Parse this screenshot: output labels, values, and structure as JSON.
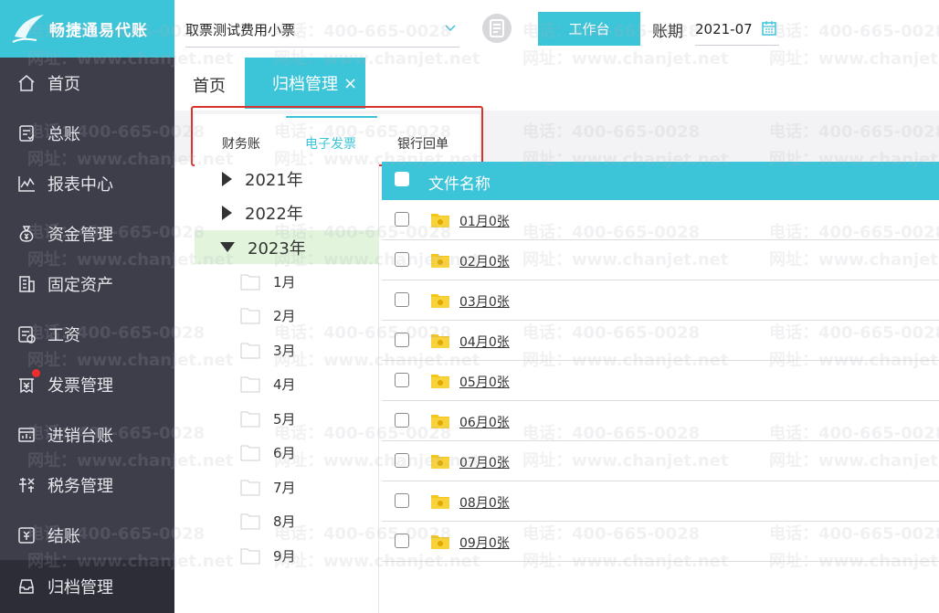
{
  "app": {
    "logo_text": "畅捷通易代账"
  },
  "sidebar": {
    "items": [
      {
        "label": "首页",
        "icon": "home-icon"
      },
      {
        "label": "总账",
        "icon": "ledger-icon"
      },
      {
        "label": "报表中心",
        "icon": "chart-icon"
      },
      {
        "label": "资金管理",
        "icon": "money-bag-icon"
      },
      {
        "label": "固定资产",
        "icon": "building-icon"
      },
      {
        "label": "工资",
        "icon": "salary-icon"
      },
      {
        "label": "发票管理",
        "icon": "invoice-icon"
      },
      {
        "label": "进销台账",
        "icon": "inventory-icon"
      },
      {
        "label": "税务管理",
        "icon": "tax-icon"
      },
      {
        "label": "结账",
        "icon": "closing-icon"
      },
      {
        "label": "归档管理",
        "icon": "archive-icon"
      }
    ]
  },
  "header": {
    "company": "取票测试费用小票",
    "workbench_label": "工作台",
    "period_label": "账期",
    "period_value": "2021-07"
  },
  "tabs": {
    "home": "首页",
    "archive": "归档管理",
    "close": "×"
  },
  "subtabs": [
    "财务账",
    "电子发票",
    "银行回单"
  ],
  "tree": {
    "years": [
      "2021年",
      "2022年",
      "2023年"
    ],
    "months": [
      "1月",
      "2月",
      "3月",
      "4月",
      "5月",
      "6月",
      "7月",
      "8月",
      "9月"
    ]
  },
  "table": {
    "header": "文件名称",
    "rows": [
      "01月0张",
      "02月0张",
      "03月0张",
      "04月0张",
      "05月0张",
      "06月0张",
      "07月0张",
      "08月0张",
      "09月0张"
    ]
  },
  "watermark": {
    "phone": "电话：400-665-0028",
    "site": "网址：www.chanjet.net"
  },
  "colors": {
    "accent": "#3cc4d8",
    "sidebar": "#3d3e4a",
    "highlight": "#d9342b",
    "folder": "#f5c518"
  }
}
